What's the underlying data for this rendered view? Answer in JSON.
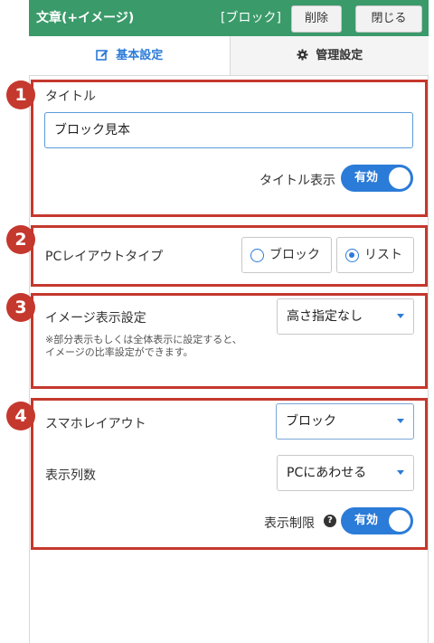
{
  "header": {
    "title": "文章(+イメージ)",
    "block_kind": "[ブロック]",
    "delete_label": "削除",
    "close_label": "閉じる"
  },
  "tabs": {
    "basic": "基本設定",
    "manage": "管理設定"
  },
  "section1": {
    "number": "1",
    "title_label": "タイトル",
    "title_value": "ブロック見本",
    "show_title_label": "タイトル表示",
    "show_title_toggle": "有効"
  },
  "section2": {
    "number": "2",
    "layout_label": "PCレイアウトタイプ",
    "options": [
      "ブロック",
      "リスト"
    ],
    "selected": "リスト"
  },
  "section3": {
    "number": "3",
    "image_label": "イメージ表示設定",
    "image_value": "高さ指定なし",
    "note_line1": "※部分表示もしくは全体表示に設定すると、",
    "note_line2": "イメージの比率設定ができます。"
  },
  "section4": {
    "number": "4",
    "sp_layout_label": "スマホレイアウト",
    "sp_layout_value": "ブロック",
    "columns_label": "表示列数",
    "columns_value": "PCにあわせる",
    "limit_label": "表示制限",
    "limit_help": "?",
    "limit_toggle": "有効"
  },
  "colors": {
    "header_green": "#3a9a6a",
    "accent_blue": "#2b7bd8",
    "highlight_red": "#c5382d"
  }
}
